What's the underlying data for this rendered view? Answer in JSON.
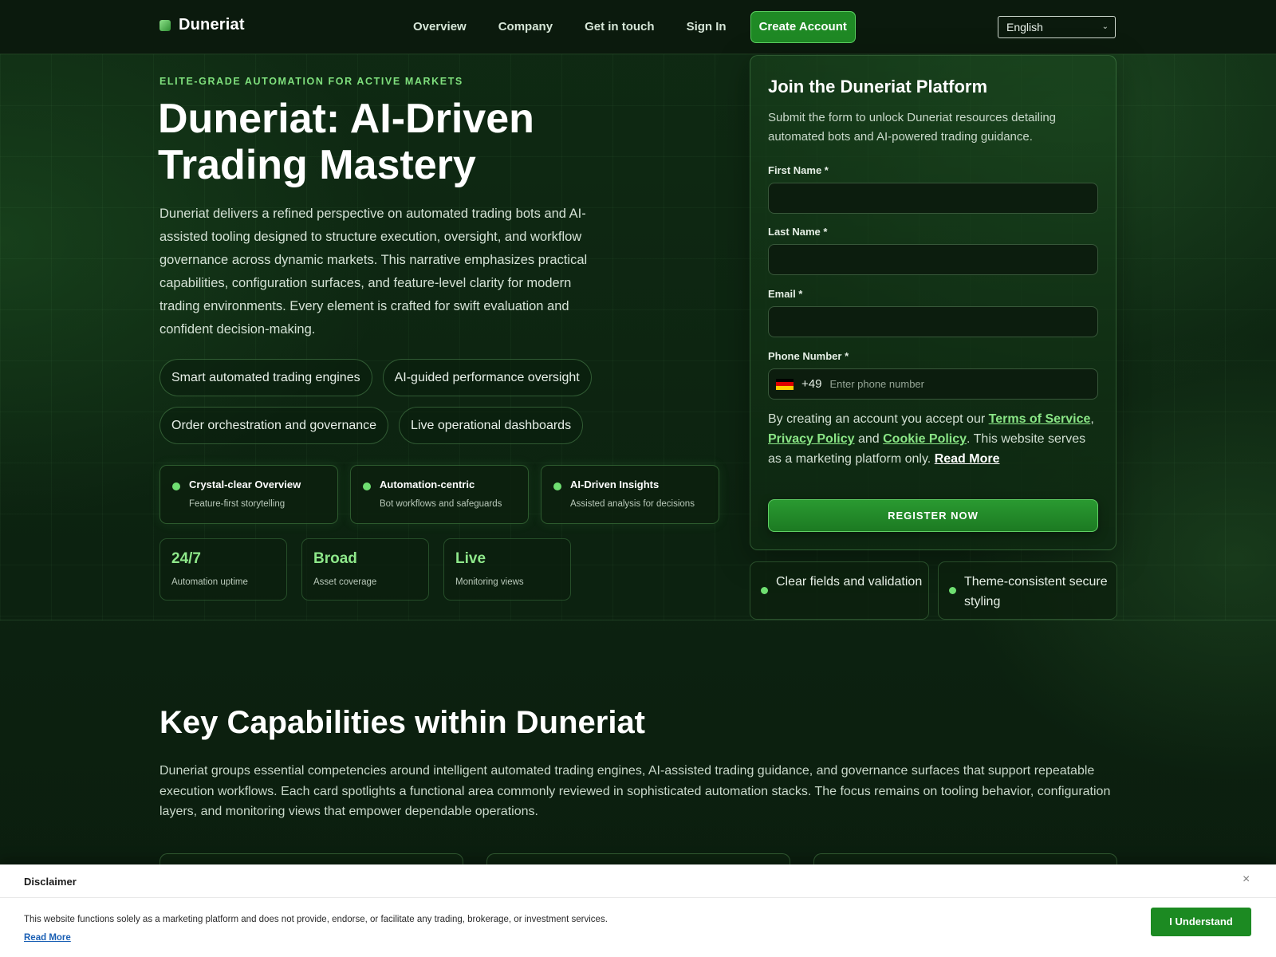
{
  "header": {
    "logo_text": "Duneriat",
    "nav": [
      "Overview",
      "Company",
      "Get in touch",
      "Sign In"
    ],
    "cta": "Create Account",
    "language": "English"
  },
  "hero": {
    "eyebrow": "ELITE-GRADE AUTOMATION FOR ACTIVE MARKETS",
    "title": "Duneriat: AI-Driven Trading Mastery",
    "description": "Duneriat delivers a refined perspective on automated trading bots and AI-assisted tooling designed to structure execution, oversight, and workflow governance across dynamic markets. This narrative emphasizes practical capabilities, configuration surfaces, and feature-level clarity for modern trading environments. Every element is crafted for swift evaluation and confident decision-making.",
    "pills": [
      "Smart automated trading engines",
      "AI-guided performance oversight",
      "Order orchestration and governance",
      "Live operational dashboards"
    ],
    "features": [
      {
        "title": "Crystal-clear Overview",
        "subtitle": "Feature-first storytelling"
      },
      {
        "title": "Automation-centric",
        "subtitle": "Bot workflows and safeguards"
      },
      {
        "title": "AI-Driven Insights",
        "subtitle": "Assisted analysis for decisions"
      }
    ],
    "stats": [
      {
        "value": "24/7",
        "label": "Automation uptime"
      },
      {
        "value": "Broad",
        "label": "Asset coverage"
      },
      {
        "value": "Live",
        "label": "Monitoring views"
      }
    ]
  },
  "form": {
    "title": "Join the Duneriat Platform",
    "subtitle": "Submit the form to unlock Duneriat resources detailing automated bots and AI-powered trading guidance.",
    "first_name_label": "First Name *",
    "last_name_label": "Last Name *",
    "email_label": "Email *",
    "phone_label": "Phone Number *",
    "phone_code": "+49",
    "phone_placeholder": "Enter phone number",
    "legal_prefix": "By creating an account you accept our",
    "terms": "Terms of Service",
    "privacy": "Privacy Policy",
    "and": "and",
    "cookie": "Cookie Policy",
    "legal_suffix": ". This website serves as a marketing platform only.",
    "read_more": "Read More",
    "submit": "REGISTER NOW"
  },
  "mini_cards": [
    "Clear fields and validation",
    "Theme-consistent secure styling"
  ],
  "capabilities": {
    "title": "Key Capabilities within Duneriat",
    "description": "Duneriat groups essential competencies around intelligent automated trading engines, AI-assisted trading guidance, and governance surfaces that support repeatable execution workflows. Each card spotlights a functional area commonly reviewed in sophisticated automation stacks. The focus remains on tooling behavior, configuration layers, and monitoring views that empower dependable operations."
  },
  "disclaimer": {
    "title": "Disclaimer",
    "close": "×",
    "text": "This website functions solely as a marketing platform and does not provide, endorse, or facilitate any trading, brokerage, or investment services.",
    "read_more": "Read More",
    "button": "I Understand"
  },
  "colors": {
    "accent": "#1f8a25",
    "accent_light": "#8ee88a",
    "background": "#0d1f10"
  }
}
